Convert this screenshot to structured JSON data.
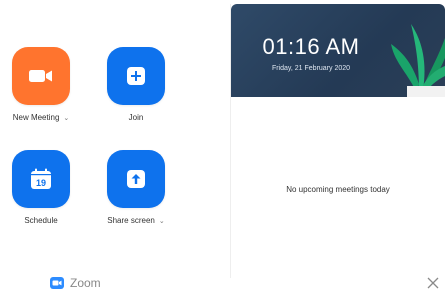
{
  "actions": {
    "new_meeting": {
      "label": "New Meeting",
      "color": "#ff742e",
      "chevron": "⌄"
    },
    "join": {
      "label": "Join",
      "color": "#0e72ed"
    },
    "schedule": {
      "label": "Schedule",
      "color": "#0e72ed",
      "day": "19"
    },
    "share_screen": {
      "label": "Share screen",
      "color": "#0e72ed",
      "chevron": "⌄"
    }
  },
  "panel": {
    "time": "01:16 AM",
    "date": "Friday, 21 February 2020",
    "empty_text": "No upcoming meetings today"
  },
  "footer": {
    "brand": "Zoom"
  },
  "icons": [
    "video-camera-icon",
    "plus-icon",
    "calendar-icon",
    "share-arrow-icon",
    "plant-icon",
    "zoom-logo-icon",
    "close-icon"
  ]
}
